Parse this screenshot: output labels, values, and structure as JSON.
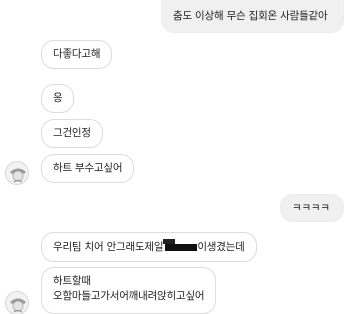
{
  "messages": [
    {
      "side": "out",
      "text": "춤도 이상해 무슨 집회온 사람들같아"
    },
    {
      "side": "in",
      "text": "다좋다고해"
    },
    {
      "side": "in",
      "text": "응"
    },
    {
      "side": "in",
      "text": "그건인정"
    },
    {
      "side": "in",
      "text": "하트 부수고싶어"
    },
    {
      "side": "out",
      "text": "ㅋㅋㅋㅋ"
    },
    {
      "side": "in",
      "text_before": "우리팀 치어 안그래도제일",
      "text_after": "이생겼는데"
    },
    {
      "side": "in",
      "line1": "하트할때",
      "line2": "오함마들고가서어깨내려앉히고싶어"
    }
  ]
}
